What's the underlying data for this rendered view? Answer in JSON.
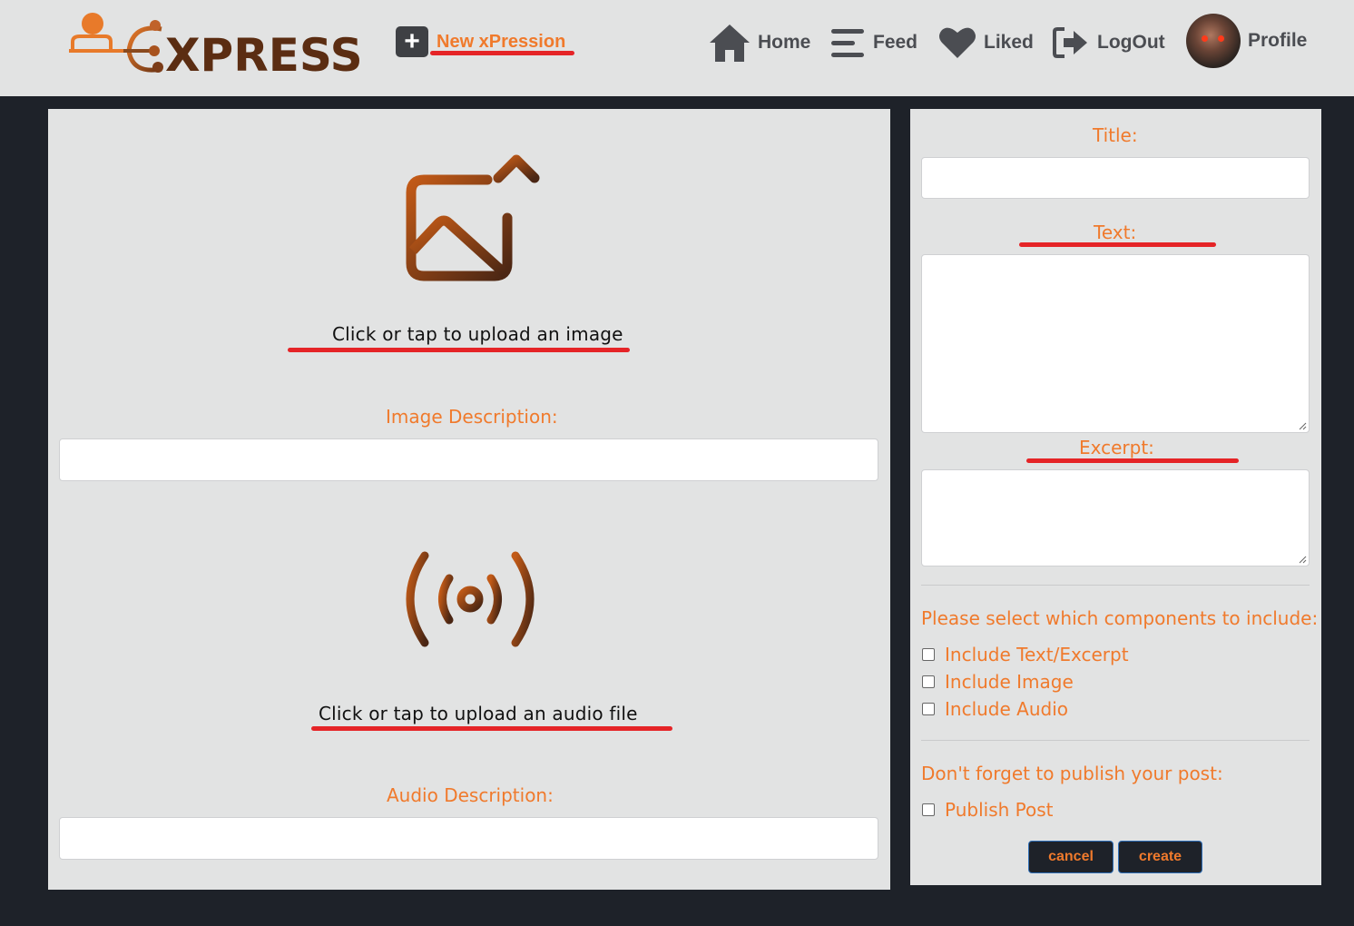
{
  "header": {
    "logo_text": "XPRESS",
    "new_label": "New xPression",
    "nav": [
      {
        "label": "Home",
        "icon": "home-icon"
      },
      {
        "label": "Feed",
        "icon": "menu-icon"
      },
      {
        "label": "Liked",
        "icon": "heart-icon"
      },
      {
        "label": "LogOut",
        "icon": "logout-icon"
      },
      {
        "label": "Profile",
        "icon": "avatar"
      }
    ]
  },
  "left": {
    "image_hint": "Click or tap to upload an image",
    "image_desc_label": "Image Description:",
    "image_desc_value": "",
    "audio_hint": "Click or tap to upload an audio file",
    "audio_desc_label": "Audio Description:",
    "audio_desc_value": ""
  },
  "right": {
    "title_label": "Title:",
    "title_value": "",
    "text_label": "Text:",
    "text_value": "",
    "excerpt_label": "Excerpt:",
    "excerpt_value": "",
    "components_prompt": "Please select which components to include:",
    "components": [
      {
        "label": "Include Text/Excerpt",
        "checked": false
      },
      {
        "label": "Include Image",
        "checked": false
      },
      {
        "label": "Include Audio",
        "checked": false
      }
    ],
    "publish_prompt": "Don't forget to publish your post:",
    "publish_label": "Publish Post",
    "publish_checked": false,
    "cancel_label": "cancel",
    "create_label": "create"
  },
  "colors": {
    "accent": "#f07a2c",
    "brand_dark": "#5b2d12",
    "annotation_red": "#e52427",
    "page_bg": "#1e2229",
    "panel_bg": "#e2e3e3"
  }
}
